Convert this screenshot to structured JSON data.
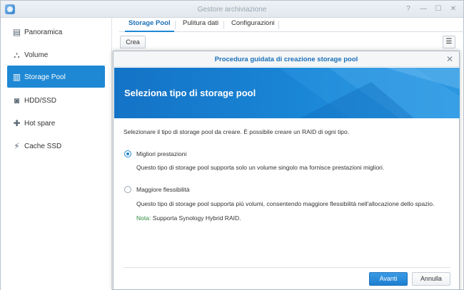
{
  "window": {
    "title": "Gestore archiviazione",
    "controls": [
      "?",
      "—",
      "☐",
      "✕"
    ]
  },
  "sidebar": {
    "items": [
      {
        "label": "Panoramica",
        "icon": "overview-icon",
        "glyph": "▤"
      },
      {
        "label": "Volume",
        "icon": "volume-icon",
        "glyph": "⛬"
      },
      {
        "label": "Storage Pool",
        "icon": "storage-pool-icon",
        "glyph": "▥",
        "active": true
      },
      {
        "label": "HDD/SSD",
        "icon": "disk-icon",
        "glyph": "◙"
      },
      {
        "label": "Hot spare",
        "icon": "hot-spare-icon",
        "glyph": "✚"
      },
      {
        "label": "Cache SSD",
        "icon": "cache-ssd-icon",
        "glyph": "⚡"
      }
    ]
  },
  "tabs": [
    {
      "label": "Storage Pool",
      "active": true
    },
    {
      "label": "Pulitura dati"
    },
    {
      "label": "Configurazioni"
    }
  ],
  "toolbar": {
    "create_label": "Crea",
    "sort_icon": "sort-icon"
  },
  "dialog": {
    "title": "Procedura guidata di creazione storage pool",
    "banner_title": "Seleziona tipo di storage pool",
    "intro": "Selezionare il tipo di storage pool da creare. È possibile creare un RAID di ogni tipo.",
    "options": [
      {
        "label": "Migliori prestazioni",
        "description": "Questo tipo di storage pool supporta solo un volume singolo ma fornisce prestazioni migliori.",
        "checked": true
      },
      {
        "label": "Maggiore flessibilità",
        "description": "Questo tipo di storage pool supporta più volumi, consentendo maggiore flessibilità nell'allocazione dello spazio.",
        "checked": false
      }
    ],
    "note_key": "Nota:",
    "note_text": " Supporta Synology Hybrid RAID.",
    "next_label": "Avanti",
    "cancel_label": "Annulla"
  },
  "colors": {
    "accent": "#1e88d4",
    "banner": "#1a86d6",
    "note": "#2f8a3e"
  }
}
